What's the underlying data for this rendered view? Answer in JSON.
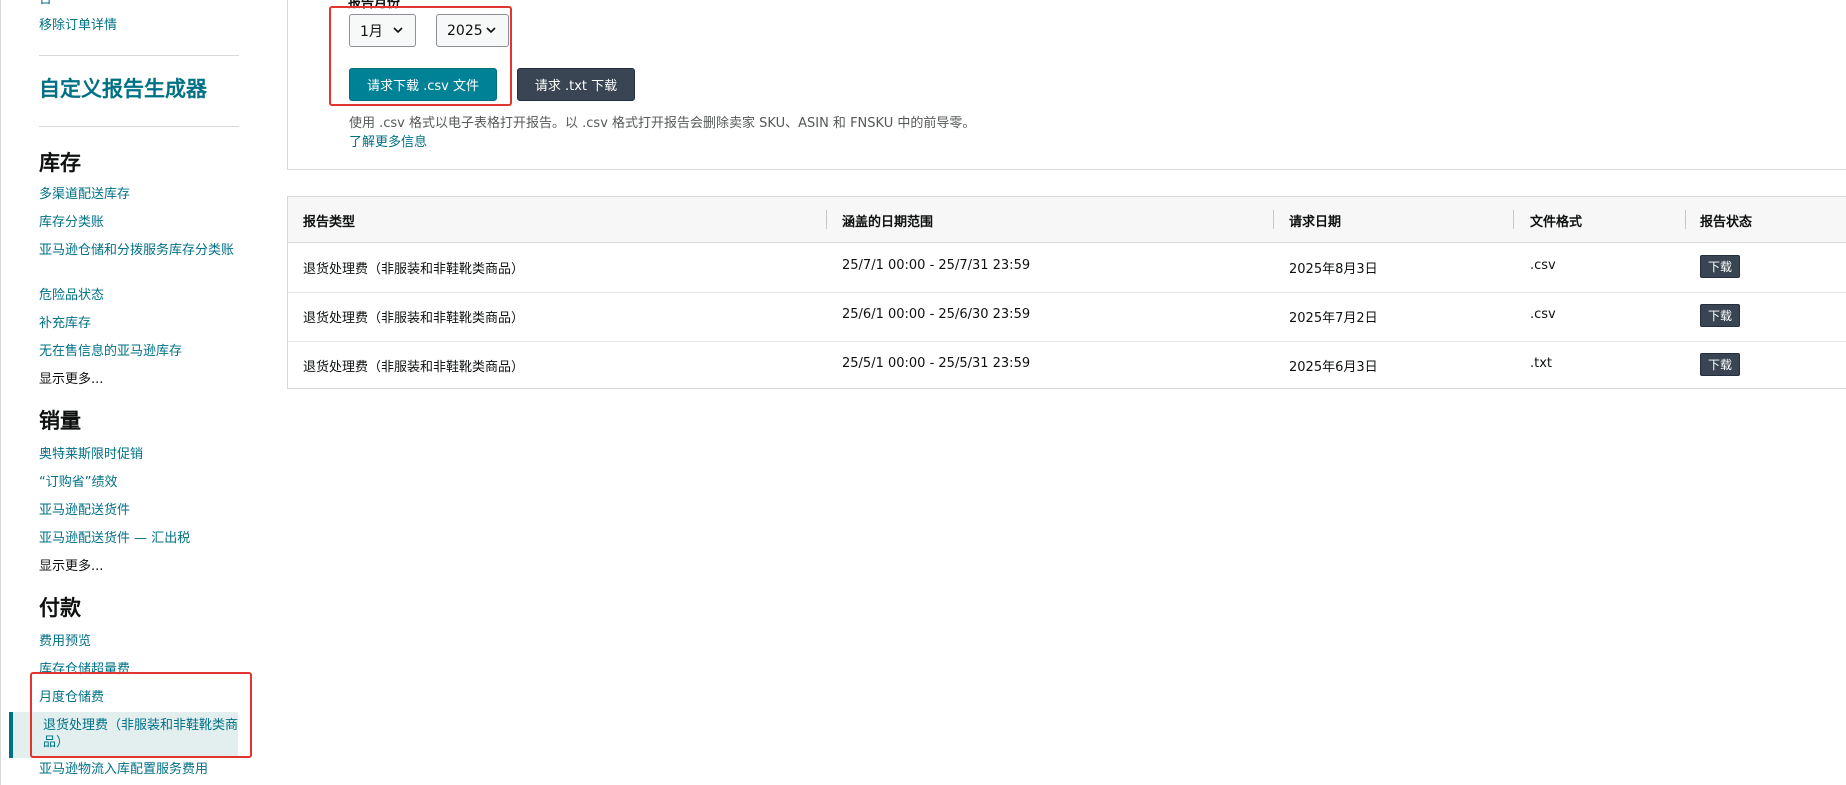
{
  "sidebar": {
    "top_partial": "台",
    "top_link": "移除订单详情",
    "title": "自定义报告生成器",
    "sections": [
      {
        "heading": "库存",
        "items": [
          "多渠道配送库存",
          "库存分类账",
          "亚马逊仓储和分拨服务库存分类账",
          "危险品状态",
          "补充库存",
          "无在售信息的亚马逊库存"
        ],
        "more": "显示更多..."
      },
      {
        "heading": "销量",
        "items": [
          "奥特莱斯限时促销",
          "“订购省”绩效",
          "亚马逊配送货件",
          "亚马逊配送货件 — 汇出税"
        ],
        "more": "显示更多..."
      },
      {
        "heading": "付款",
        "items": [
          "费用预览",
          "库存仓储超量费",
          "月度仓储费"
        ],
        "active": "退货处理费（非服装和非鞋靴类商品）",
        "after": "亚马逊物流入库配置服务费用"
      }
    ]
  },
  "form": {
    "label": "报告月份",
    "month_value": "1月",
    "year_value": "2025",
    "csv_button": "请求下载 .csv 文件",
    "txt_button": "请求 .txt 下载",
    "help_text": "使用 .csv 格式以电子表格打开报告。以 .csv 格式打开报告会删除卖家 SKU、ASIN 和 FNSKU 中的前导零。",
    "help_link": "了解更多信息"
  },
  "table": {
    "headers": [
      "报告类型",
      "涵盖的日期范围",
      "请求日期",
      "文件格式",
      "报告状态"
    ],
    "rows": [
      {
        "type": "退货处理费（非服装和非鞋靴类商品）",
        "range": "25/7/1 00:00 - 25/7/31 23:59",
        "date": "2025年8月3日",
        "format": ".csv",
        "status": "下载"
      },
      {
        "type": "退货处理费（非服装和非鞋靴类商品）",
        "range": "25/6/1 00:00 - 25/6/30 23:59",
        "date": "2025年7月2日",
        "format": ".csv",
        "status": "下载"
      },
      {
        "type": "退货处理费（非服装和非鞋靴类商品）",
        "range": "25/5/1 00:00 - 25/5/31 23:59",
        "date": "2025年6月3日",
        "format": ".txt",
        "status": "下载"
      }
    ]
  },
  "icons": {
    "select_chevron": "chevron-down-icon"
  },
  "colors": {
    "link": "#007185",
    "primary_button": "#008296",
    "dark_button": "#3a4553",
    "highlight": "#e3342f"
  }
}
